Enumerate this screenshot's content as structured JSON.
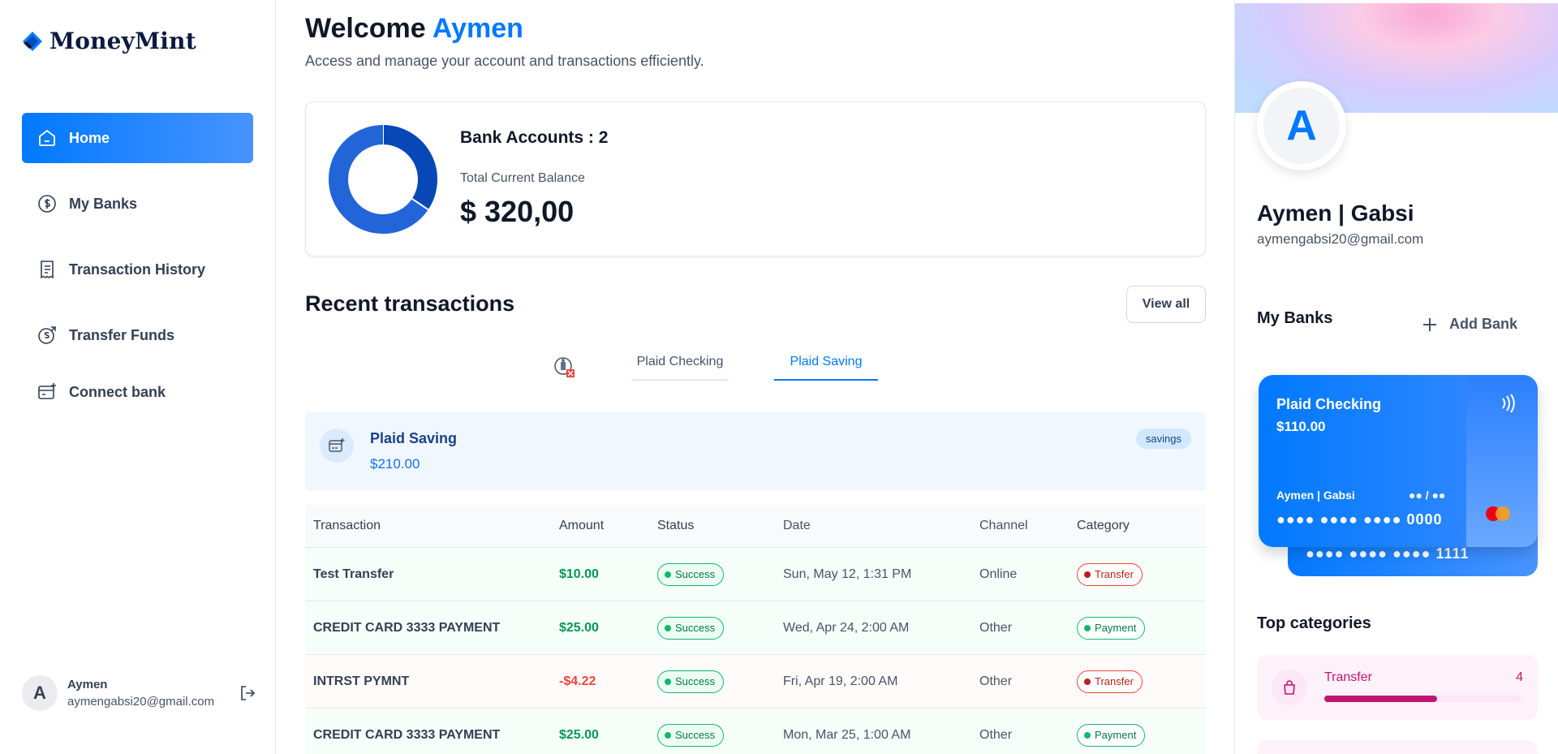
{
  "brand": {
    "name": "MoneyMint"
  },
  "sidebar": {
    "items": [
      {
        "label": "Home",
        "icon": "home-icon",
        "active": true
      },
      {
        "label": "My Banks",
        "icon": "dollar-icon",
        "active": false
      },
      {
        "label": "Transaction History",
        "icon": "receipt-icon",
        "active": false
      },
      {
        "label": "Transfer Funds",
        "icon": "money-send-icon",
        "active": false
      },
      {
        "label": "Connect bank",
        "icon": "card-add-icon",
        "active": false
      }
    ],
    "user": {
      "initial": "A",
      "name": "Aymen",
      "email": "aymengabsi20@gmail.com"
    }
  },
  "header": {
    "welcome_prefix": "Welcome",
    "user_first_name": "Aymen",
    "subtitle": "Access and manage your account and transactions efficiently."
  },
  "balance": {
    "bank_accounts_label": "Bank Accounts : 2",
    "total_label": "Total Current Balance",
    "total_value": "$ 320,00",
    "chart_data": {
      "type": "pie",
      "categories": [
        "Plaid Checking",
        "Plaid Saving"
      ],
      "values": [
        110,
        210
      ],
      "colors": [
        "#0747b6",
        "#2265d8"
      ]
    }
  },
  "recent": {
    "title": "Recent transactions",
    "view_all": "View all",
    "tabs": [
      {
        "label": "Plaid Checking",
        "active": false
      },
      {
        "label": "Plaid Saving",
        "active": true
      }
    ],
    "account": {
      "name": "Plaid Saving",
      "balance": "$210.00",
      "type": "savings"
    },
    "columns": [
      "Transaction",
      "Amount",
      "Status",
      "Date",
      "Channel",
      "Category"
    ],
    "rows": [
      {
        "name": "Test Transfer",
        "amount": "$10.00",
        "sign": "pos",
        "status": "Success",
        "date": "Sun, May 12, 1:31 PM",
        "channel": "Online",
        "category": "Transfer"
      },
      {
        "name": "CREDIT CARD 3333 PAYMENT",
        "amount": "$25.00",
        "sign": "pos",
        "status": "Success",
        "date": "Wed, Apr 24, 2:00 AM",
        "channel": "Other",
        "category": "Payment"
      },
      {
        "name": "INTRST PYMNT",
        "amount": "-$4.22",
        "sign": "neg",
        "status": "Success",
        "date": "Fri, Apr 19, 2:00 AM",
        "channel": "Other",
        "category": "Transfer"
      },
      {
        "name": "CREDIT CARD 3333 PAYMENT",
        "amount": "$25.00",
        "sign": "pos",
        "status": "Success",
        "date": "Mon, Mar 25, 1:00 AM",
        "channel": "Other",
        "category": "Payment"
      }
    ]
  },
  "profile": {
    "initial": "A",
    "full_name": "Aymen | Gabsi",
    "email": "aymengabsi20@gmail.com",
    "my_banks_label": "My Banks",
    "add_bank_label": "Add Bank"
  },
  "cards": {
    "front": {
      "bank": "Plaid Checking",
      "amount": "$110.00",
      "holder": "Aymen | Gabsi",
      "expiry": "●● / ●●",
      "number": "●●●● ●●●● ●●●● 0000"
    },
    "back": {
      "number": "●●●● ●●●● ●●●● 1111"
    }
  },
  "top_categories": {
    "title": "Top categories",
    "items": [
      {
        "name": "Transfer",
        "count": "4",
        "fill": 0.57
      }
    ]
  }
}
